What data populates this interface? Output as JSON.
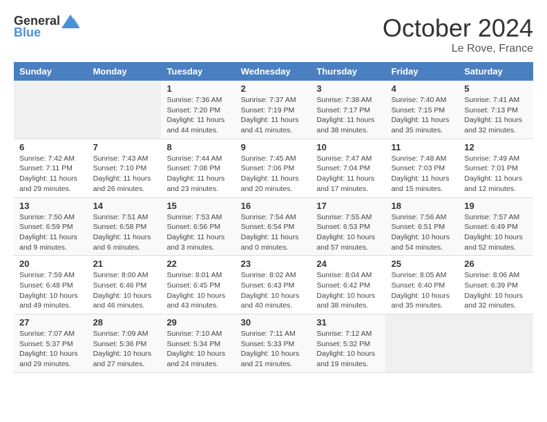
{
  "header": {
    "logo_general": "General",
    "logo_blue": "Blue",
    "month": "October 2024",
    "location": "Le Rove, France"
  },
  "days_of_week": [
    "Sunday",
    "Monday",
    "Tuesday",
    "Wednesday",
    "Thursday",
    "Friday",
    "Saturday"
  ],
  "weeks": [
    [
      {
        "day": "",
        "info": ""
      },
      {
        "day": "",
        "info": ""
      },
      {
        "day": "1",
        "info": "Sunrise: 7:36 AM\nSunset: 7:20 PM\nDaylight: 11 hours and 44 minutes."
      },
      {
        "day": "2",
        "info": "Sunrise: 7:37 AM\nSunset: 7:19 PM\nDaylight: 11 hours and 41 minutes."
      },
      {
        "day": "3",
        "info": "Sunrise: 7:38 AM\nSunset: 7:17 PM\nDaylight: 11 hours and 38 minutes."
      },
      {
        "day": "4",
        "info": "Sunrise: 7:40 AM\nSunset: 7:15 PM\nDaylight: 11 hours and 35 minutes."
      },
      {
        "day": "5",
        "info": "Sunrise: 7:41 AM\nSunset: 7:13 PM\nDaylight: 11 hours and 32 minutes."
      }
    ],
    [
      {
        "day": "6",
        "info": "Sunrise: 7:42 AM\nSunset: 7:11 PM\nDaylight: 11 hours and 29 minutes."
      },
      {
        "day": "7",
        "info": "Sunrise: 7:43 AM\nSunset: 7:10 PM\nDaylight: 11 hours and 26 minutes."
      },
      {
        "day": "8",
        "info": "Sunrise: 7:44 AM\nSunset: 7:08 PM\nDaylight: 11 hours and 23 minutes."
      },
      {
        "day": "9",
        "info": "Sunrise: 7:45 AM\nSunset: 7:06 PM\nDaylight: 11 hours and 20 minutes."
      },
      {
        "day": "10",
        "info": "Sunrise: 7:47 AM\nSunset: 7:04 PM\nDaylight: 11 hours and 17 minutes."
      },
      {
        "day": "11",
        "info": "Sunrise: 7:48 AM\nSunset: 7:03 PM\nDaylight: 11 hours and 15 minutes."
      },
      {
        "day": "12",
        "info": "Sunrise: 7:49 AM\nSunset: 7:01 PM\nDaylight: 11 hours and 12 minutes."
      }
    ],
    [
      {
        "day": "13",
        "info": "Sunrise: 7:50 AM\nSunset: 6:59 PM\nDaylight: 11 hours and 9 minutes."
      },
      {
        "day": "14",
        "info": "Sunrise: 7:51 AM\nSunset: 6:58 PM\nDaylight: 11 hours and 6 minutes."
      },
      {
        "day": "15",
        "info": "Sunrise: 7:53 AM\nSunset: 6:56 PM\nDaylight: 11 hours and 3 minutes."
      },
      {
        "day": "16",
        "info": "Sunrise: 7:54 AM\nSunset: 6:54 PM\nDaylight: 11 hours and 0 minutes."
      },
      {
        "day": "17",
        "info": "Sunrise: 7:55 AM\nSunset: 6:53 PM\nDaylight: 10 hours and 57 minutes."
      },
      {
        "day": "18",
        "info": "Sunrise: 7:56 AM\nSunset: 6:51 PM\nDaylight: 10 hours and 54 minutes."
      },
      {
        "day": "19",
        "info": "Sunrise: 7:57 AM\nSunset: 6:49 PM\nDaylight: 10 hours and 52 minutes."
      }
    ],
    [
      {
        "day": "20",
        "info": "Sunrise: 7:59 AM\nSunset: 6:48 PM\nDaylight: 10 hours and 49 minutes."
      },
      {
        "day": "21",
        "info": "Sunrise: 8:00 AM\nSunset: 6:46 PM\nDaylight: 10 hours and 46 minutes."
      },
      {
        "day": "22",
        "info": "Sunrise: 8:01 AM\nSunset: 6:45 PM\nDaylight: 10 hours and 43 minutes."
      },
      {
        "day": "23",
        "info": "Sunrise: 8:02 AM\nSunset: 6:43 PM\nDaylight: 10 hours and 40 minutes."
      },
      {
        "day": "24",
        "info": "Sunrise: 8:04 AM\nSunset: 6:42 PM\nDaylight: 10 hours and 38 minutes."
      },
      {
        "day": "25",
        "info": "Sunrise: 8:05 AM\nSunset: 6:40 PM\nDaylight: 10 hours and 35 minutes."
      },
      {
        "day": "26",
        "info": "Sunrise: 8:06 AM\nSunset: 6:39 PM\nDaylight: 10 hours and 32 minutes."
      }
    ],
    [
      {
        "day": "27",
        "info": "Sunrise: 7:07 AM\nSunset: 5:37 PM\nDaylight: 10 hours and 29 minutes."
      },
      {
        "day": "28",
        "info": "Sunrise: 7:09 AM\nSunset: 5:36 PM\nDaylight: 10 hours and 27 minutes."
      },
      {
        "day": "29",
        "info": "Sunrise: 7:10 AM\nSunset: 5:34 PM\nDaylight: 10 hours and 24 minutes."
      },
      {
        "day": "30",
        "info": "Sunrise: 7:11 AM\nSunset: 5:33 PM\nDaylight: 10 hours and 21 minutes."
      },
      {
        "day": "31",
        "info": "Sunrise: 7:12 AM\nSunset: 5:32 PM\nDaylight: 10 hours and 19 minutes."
      },
      {
        "day": "",
        "info": ""
      },
      {
        "day": "",
        "info": ""
      }
    ]
  ]
}
